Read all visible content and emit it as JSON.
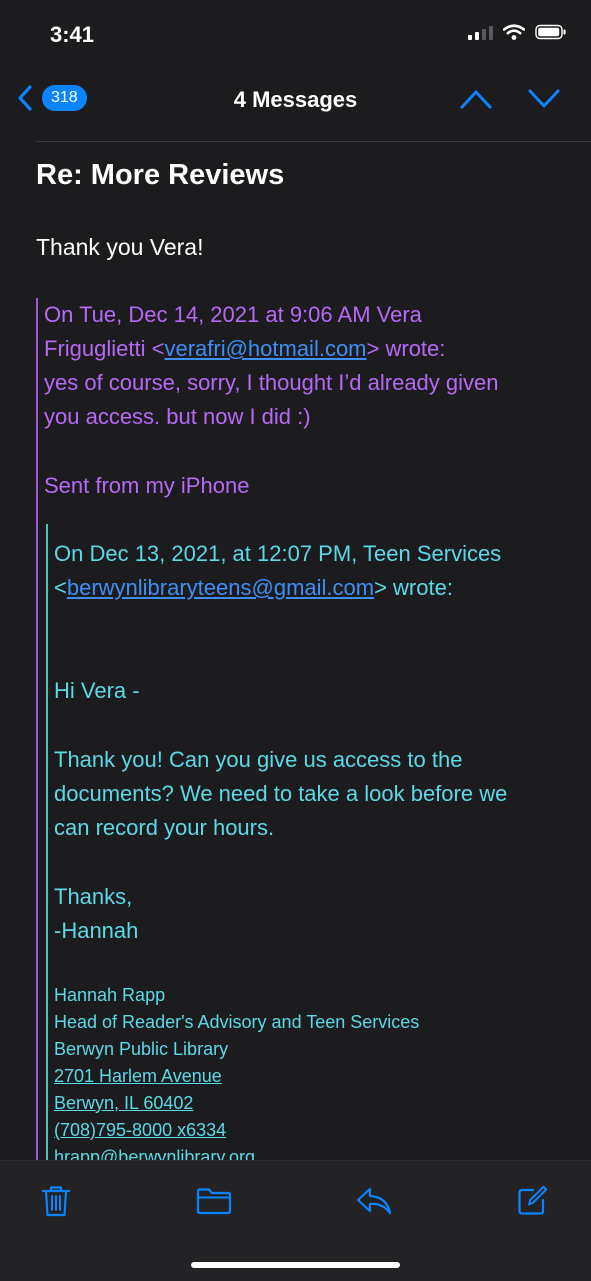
{
  "status_bar": {
    "time": "3:41"
  },
  "nav": {
    "back_count": "318",
    "title": "4 Messages"
  },
  "message": {
    "subject": "Re: More Reviews",
    "reply": "Thank you Vera!",
    "quote1": {
      "header_prefix": "On Tue, Dec 14, 2021 at 9:06 AM Vera",
      "sender_name": "Friguglietti <",
      "sender_email": "verafri@hotmail.com",
      "wrote": "> wrote:",
      "body_line1": "yes of course, sorry, I thought I’d already given",
      "body_line2": "you access. but now I did :)",
      "signature": "Sent from my iPhone"
    },
    "quote2": {
      "header_line1": "On Dec 13, 2021, at 12:07 PM, Teen Services",
      "open_bracket": "<",
      "sender_email": "berwynlibraryteens@gmail.com",
      "wrote": "> wrote:",
      "greeting": "Hi Vera -",
      "body_line1": "Thank you! Can you give us access to the",
      "body_line2": "documents? We need to take a look before we",
      "body_line3": "can record your hours.",
      "closing": "Thanks,",
      "sign_name": "-Hannah",
      "signature": {
        "name": "Hannah Rapp",
        "title": "Head of Reader's Advisory and Teen Services",
        "org": "Berwyn Public Library",
        "address": "2701 Harlem Avenue",
        "city": "Berwyn, IL 60402",
        "phone": "(708)795-8000 x6334",
        "email": "hrapp@berwynlibrary.org"
      }
    }
  },
  "toolbar": {
    "icons": [
      "trash-icon",
      "folder-icon",
      "reply-icon",
      "compose-icon"
    ]
  },
  "colors": {
    "background": "#1c1c1e",
    "accent": "#0a84ff",
    "quote1_text": "#b669f4",
    "quote2_text": "#5ad9e6",
    "link": "#3d8ef5"
  }
}
